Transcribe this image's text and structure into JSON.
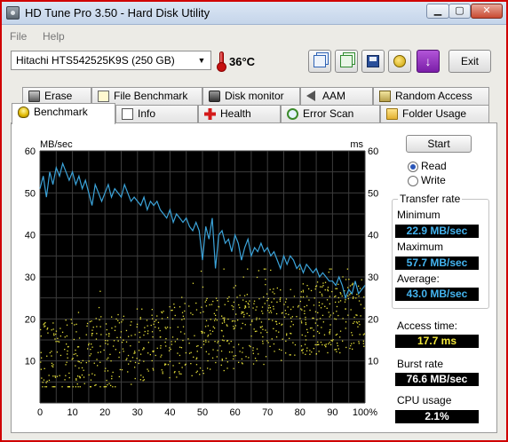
{
  "window": {
    "title": "HD Tune Pro 3.50 - Hard Disk Utility",
    "minimize": "▁",
    "maximize": "▢",
    "close": "✕"
  },
  "menu": {
    "file": "File",
    "help": "Help"
  },
  "toolbar": {
    "drive": "Hitachi HTS542525K9S (250 GB)",
    "drive_arrow": "▼",
    "temperature": "36°C",
    "icons": [
      "copy-icon",
      "copy-green-icon",
      "save-icon",
      "options-icon",
      "download-icon"
    ],
    "download_glyph": "↓",
    "exit_label": "Exit"
  },
  "tabs": {
    "row1": [
      {
        "label": "Erase",
        "icon": "trash-icon"
      },
      {
        "label": "File Benchmark",
        "icon": "file-benchmark-icon"
      },
      {
        "label": "Disk monitor",
        "icon": "disk-icon"
      },
      {
        "label": "AAM",
        "icon": "speaker-icon"
      },
      {
        "label": "Random Access",
        "icon": "random-access-icon"
      }
    ],
    "row2": [
      {
        "label": "Benchmark",
        "icon": "benchmark-icon",
        "active": true
      },
      {
        "label": "Info",
        "icon": "info-icon"
      },
      {
        "label": "Health",
        "icon": "health-icon"
      },
      {
        "label": "Error Scan",
        "icon": "magnifier-icon"
      },
      {
        "label": "Folder Usage",
        "icon": "folder-icon"
      }
    ]
  },
  "controls": {
    "start_label": "Start",
    "read_label": "Read",
    "write_label": "Write",
    "mode": "read"
  },
  "results": {
    "transfer_rate_title": "Transfer rate",
    "minimum_label": "Minimum",
    "minimum_value": "22.9 MB/sec",
    "maximum_label": "Maximum",
    "maximum_value": "57.7 MB/sec",
    "average_label": "Average:",
    "average_value": "43.0 MB/sec",
    "access_time_label": "Access time:",
    "access_time_value": "17.7 ms",
    "burst_rate_label": "Burst rate",
    "burst_rate_value": "76.6 MB/sec",
    "cpu_usage_label": "CPU usage",
    "cpu_usage_value": "2.1%"
  },
  "colors": {
    "background": "#000000",
    "grid": "#3c3c3c",
    "transfer_line": "#3ba3d9",
    "access_dots": "#e6e03a",
    "window_border": "#d00000"
  },
  "chart_data": {
    "type": "line",
    "left_axis_label": "MB/sec",
    "right_axis_label": "ms",
    "x_ticks": [
      "0",
      "10",
      "20",
      "30",
      "40",
      "50",
      "60",
      "70",
      "80",
      "90",
      "100%"
    ],
    "y_ticks": [
      "10",
      "20",
      "30",
      "40",
      "50",
      "60"
    ],
    "xlim": [
      0,
      100
    ],
    "ylim": [
      0,
      60
    ],
    "grid": true,
    "series": [
      {
        "type": "line",
        "x": [
          0,
          1,
          2,
          3,
          4,
          5,
          6,
          7,
          8,
          9,
          10,
          11,
          12,
          13,
          14,
          15,
          16,
          17,
          18,
          19,
          20,
          21,
          22,
          23,
          24,
          25,
          26,
          27,
          28,
          29,
          30,
          31,
          32,
          33,
          34,
          35,
          36,
          37,
          38,
          39,
          40,
          41,
          42,
          43,
          44,
          45,
          46,
          47,
          48,
          49,
          50,
          51,
          52,
          53,
          54,
          55,
          56,
          57,
          58,
          59,
          60,
          61,
          62,
          63,
          64,
          65,
          66,
          67,
          68,
          69,
          70,
          71,
          72,
          73,
          74,
          75,
          76,
          77,
          78,
          79,
          80,
          81,
          82,
          83,
          84,
          85,
          86,
          87,
          88,
          89,
          90,
          91,
          92,
          93,
          94,
          95,
          96,
          97,
          98,
          99,
          100
        ],
        "y": [
          51,
          54,
          49,
          55,
          52,
          56,
          54,
          57,
          55,
          53,
          55,
          52,
          54,
          51,
          53,
          50,
          47,
          52,
          50,
          48,
          50,
          52,
          49,
          51,
          50,
          49,
          52,
          50,
          48,
          49,
          48,
          47,
          49,
          46,
          48,
          47,
          48,
          46,
          45,
          44,
          46,
          43,
          45,
          44,
          43,
          44,
          42,
          41,
          43,
          41,
          34,
          42,
          39,
          44,
          32,
          40,
          41,
          38,
          39,
          36,
          40,
          38,
          34,
          37,
          39,
          35,
          37,
          36,
          38,
          36,
          37,
          35,
          36,
          34,
          32,
          35,
          33,
          35,
          34,
          32,
          33,
          31,
          33,
          32,
          31,
          32,
          30,
          31,
          30,
          29,
          29,
          28,
          30,
          28,
          25,
          27,
          26,
          29,
          26,
          27,
          28
        ]
      },
      {
        "type": "scatter",
        "note": "access time scatter (right axis, ms)",
        "y_range": [
          5,
          32
        ]
      }
    ]
  }
}
